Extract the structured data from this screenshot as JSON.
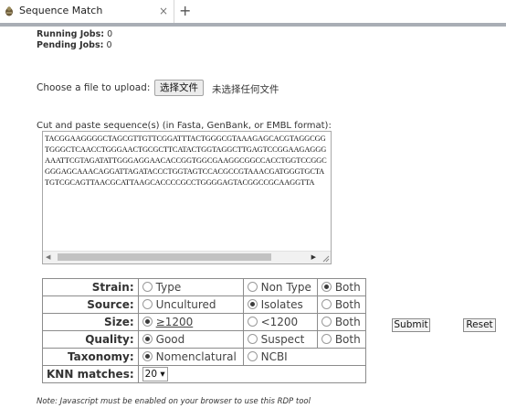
{
  "tab": {
    "title": "Sequence Match",
    "close_glyph": "×",
    "new_tab_glyph": "+"
  },
  "status": {
    "running_label": "Running Jobs:",
    "running_count": "0",
    "pending_label": "Pending Jobs:",
    "pending_count": "0"
  },
  "upload": {
    "label": "Choose a file to upload:",
    "button_label": "选择文件",
    "no_file_text": "未选择任何文件"
  },
  "sequence": {
    "label": "Cut and paste sequence(s) (in Fasta, GenBank, or EMBL format):",
    "value": "TACGGAAGGGGCTAGCGTTGTTCGGATTTACTGGGCGTAAAGAGCACGTAGGCGG\nTGGGCTCAACCTGGGAACTGCGCTTCATACTGGTAGGCTTGAGTCCGGAAGAGGG\nAAATTCGTAGATATTGGGAGGAACACCGGTGGCGAAGGCGGCCACCTGGTCCGGC\nGGGAGCAAACAGGATTAGATACCCTGGTAGTCCACGCCGTAAACGATGGGTGCTA\nTGTCGCAGTTAACGCATTAAGCACCCCGCCTGGGGAGTACGGCCGCAAGGTTA"
  },
  "options": {
    "rows": [
      {
        "label": "Strain:",
        "choices": [
          "Type",
          "Non Type",
          "Both"
        ],
        "selected": "Both"
      },
      {
        "label": "Source:",
        "choices": [
          "Uncultured",
          "Isolates",
          "Both"
        ],
        "selected": "Isolates"
      },
      {
        "label": "Size:",
        "choices": [
          "≥1200",
          "<1200",
          "Both"
        ],
        "selected": "≥1200"
      },
      {
        "label": "Quality:",
        "choices": [
          "Good",
          "Suspect",
          "Both"
        ],
        "selected": "Good"
      },
      {
        "label": "Taxonomy:",
        "choices": [
          "Nomenclatural",
          "NCBI"
        ],
        "selected": "Nomenclatural"
      }
    ],
    "knn": {
      "label": "KNN matches:",
      "value": "20",
      "arrow": "▾"
    }
  },
  "buttons": {
    "submit": "Submit",
    "reset": "Reset"
  },
  "note": "Note: Javascript must be enabled on your browser to use this RDP tool",
  "colors": {
    "tab_stripe": "#a9aeb5",
    "table_border": "#8c8c8c"
  }
}
